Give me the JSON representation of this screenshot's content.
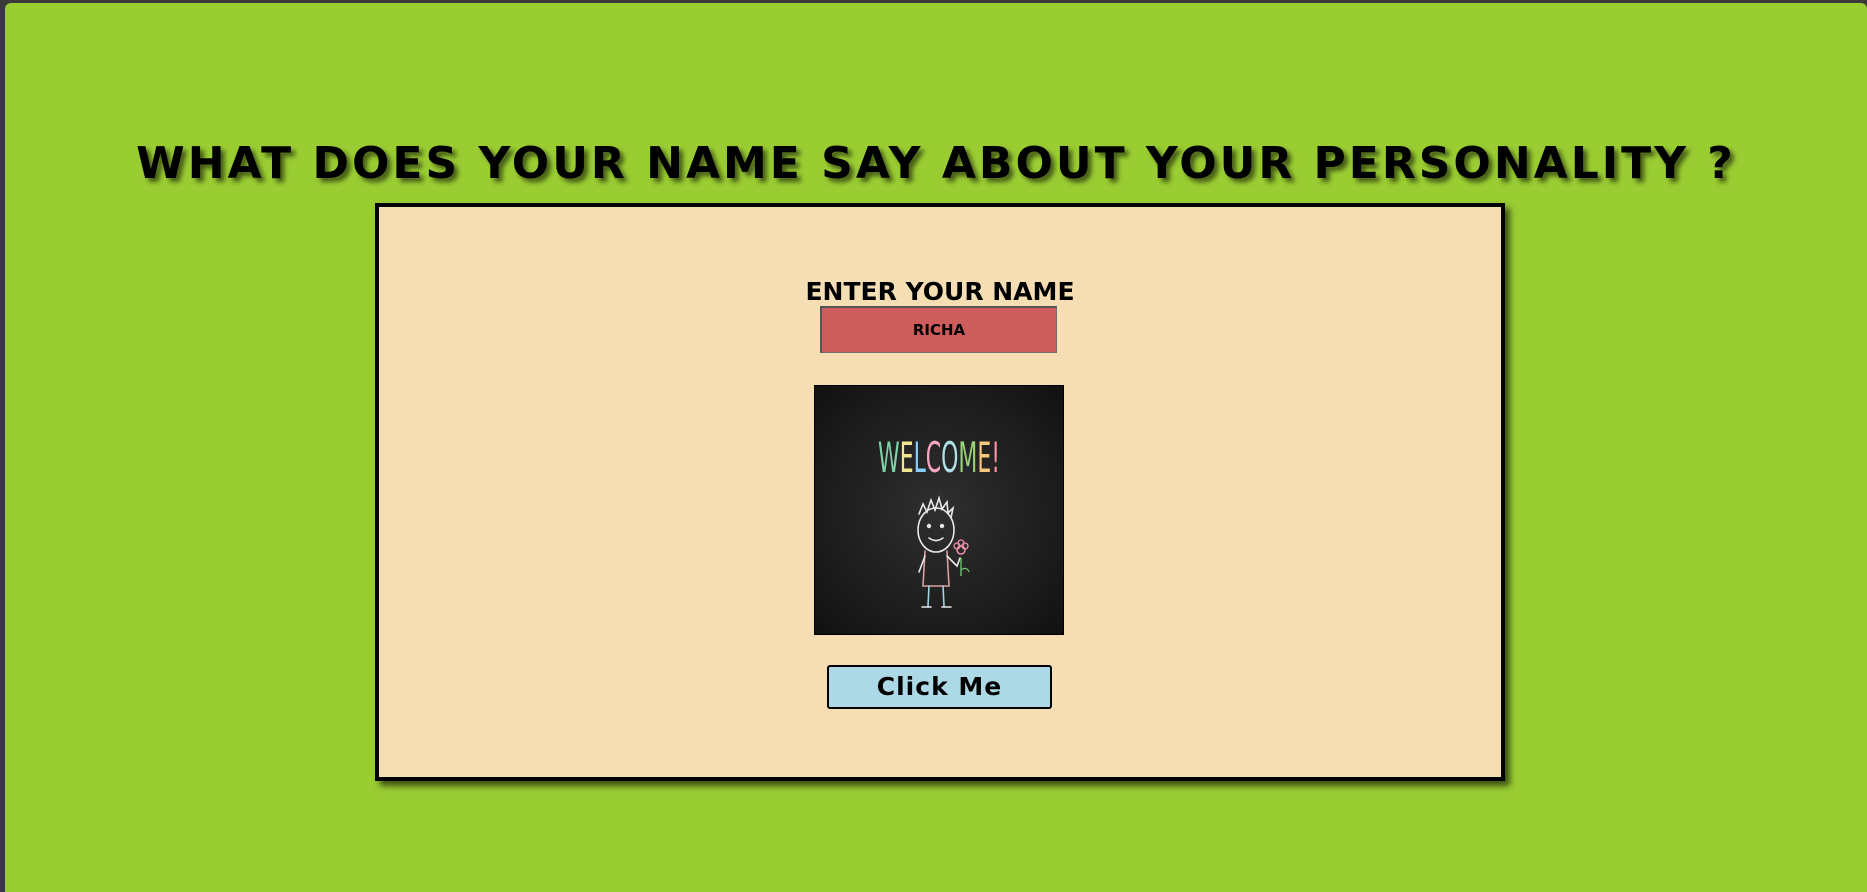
{
  "page": {
    "title": "WHAT DOES YOUR NAME SAY ABOUT YOUR PERSONALITY ?",
    "background_color": "#9acd32"
  },
  "form": {
    "label": "ENTER YOUR NAME",
    "name_value": "RICHA",
    "input_color": "#cd5c5c",
    "card_color": "#f5deb3"
  },
  "image": {
    "welcome_text": "WELCOME!",
    "description": "chalkboard-welcome-illustration"
  },
  "button": {
    "label": "Click Me",
    "color": "#add8e6"
  }
}
